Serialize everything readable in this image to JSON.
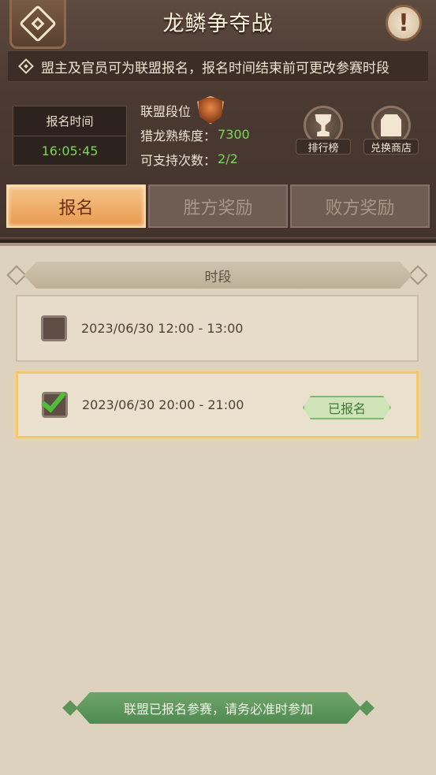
{
  "header": {
    "title": "龙鳞争夺战",
    "help_label": "!"
  },
  "notice": {
    "text": "盟主及官员可为联盟报名，报名时间结束前可更改参赛时段"
  },
  "registration_time": {
    "label": "报名时间",
    "value": "16:05:45"
  },
  "alliance": {
    "rank_label": "联盟段位",
    "rank_icon": "bronze-shield-rank-icon",
    "proficiency_label": "猎龙熟练度：",
    "proficiency_value": "7300",
    "support_label": "可支持次数：",
    "support_value": "2/2"
  },
  "side_buttons": {
    "leaderboard_label": "排行榜",
    "leaderboard_icon": "trophy-icon",
    "shop_label": "兑换商店",
    "shop_icon": "chest-icon"
  },
  "tabs": [
    {
      "label": "报名",
      "active": true
    },
    {
      "label": "胜方奖励",
      "active": false
    },
    {
      "label": "败方奖励",
      "active": false
    }
  ],
  "slots_section": {
    "header": "时段",
    "slots": [
      {
        "time": "2023/06/30 12:00 - 13:00",
        "checked": false,
        "badge": ""
      },
      {
        "time": "2023/06/30 20:00 - 21:00",
        "checked": true,
        "badge": "已报名"
      }
    ]
  },
  "footer": {
    "text": "联盟已报名参赛，请务必准时参加"
  },
  "colors": {
    "accent_green": "#7ed35a",
    "tab_active": "#e89a4f",
    "selected_border": "#f2c86a"
  }
}
